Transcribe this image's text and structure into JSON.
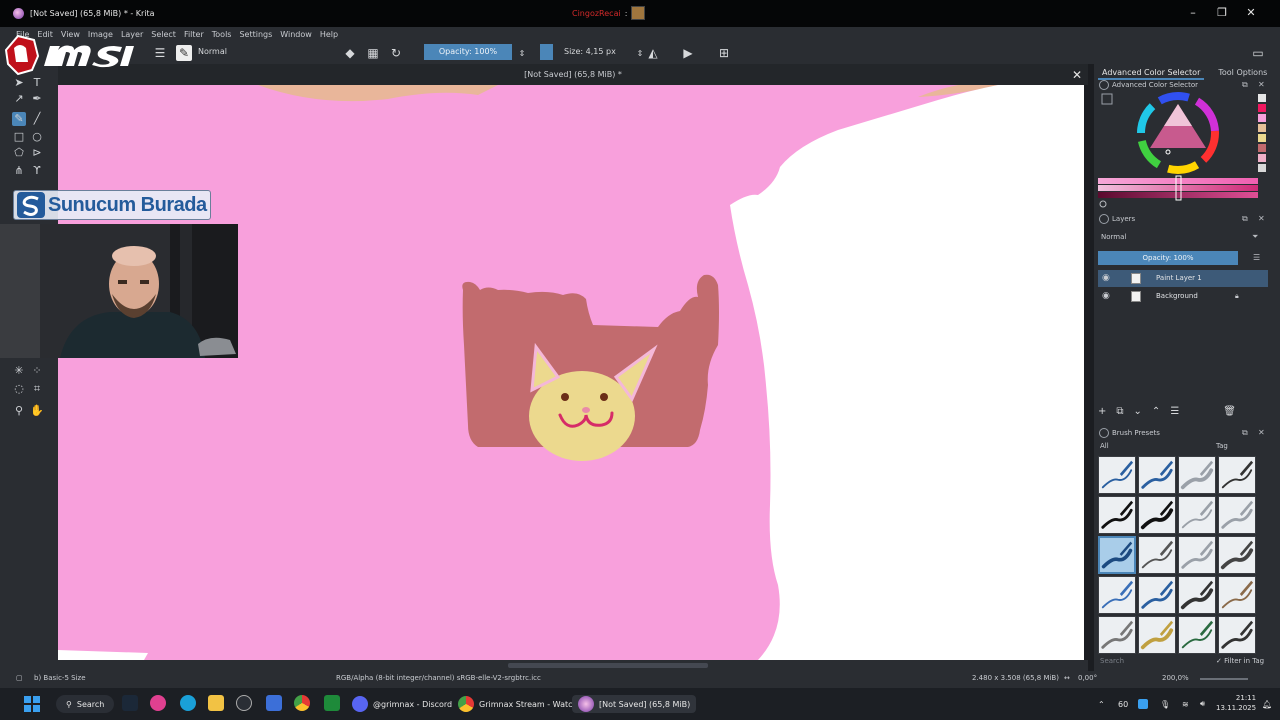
{
  "window": {
    "title": "[Not Saved]  (65,8 MiB) * - Krita",
    "center_name": "CingozRecai"
  },
  "menu": [
    "File",
    "Edit",
    "View",
    "Image",
    "Layer",
    "Select",
    "Filter",
    "Tools",
    "Settings",
    "Window",
    "Help"
  ],
  "toolbar": {
    "blend_mode": "Normal",
    "opacity": "Opacity: 100%",
    "size": "Size: 4,15 px"
  },
  "document": {
    "tab_title": "[Not Saved]  (65,8 MiB) *"
  },
  "overlay": {
    "brand_text": "Sunucum Burada"
  },
  "dock": {
    "tabs": [
      "Advanced Color Selector",
      "Tool Options"
    ],
    "color_panel_title": "Advanced Color Selector",
    "layers_title": "Layers",
    "layers_blend": "Normal",
    "layers_opacity": "Opacity:  100%",
    "layers": [
      {
        "name": "Paint Layer 1",
        "selected": true
      },
      {
        "name": "Background",
        "selected": false
      }
    ],
    "presets_title": "Brush Presets",
    "presets_filter": "All",
    "presets_tag": "Tag",
    "presets_search_placeholder": "Search",
    "filter_in_tag": "Filter in Tag"
  },
  "status": {
    "brush": "b) Basic-5 Size",
    "color_profile": "RGB/Alpha (8-bit integer/channel)  sRGB-elle-V2-srgbtrc.icc",
    "dimensions": "2.480 x 3.508 (65,8 MiB)",
    "rotation": "0,00°",
    "zoom": "200,0%"
  },
  "taskbar": {
    "search": "Search",
    "discord": "@grimnax - Discord",
    "chrome": "Grimnax Stream - Watch",
    "krita": "[Not Saved]  (65,8 MiB)",
    "tray_num": "60",
    "time": "21:11",
    "date": "13.11.2025"
  },
  "colors": {
    "canvas_pink": "#f8a0dc",
    "blob": "#c26b6e",
    "face": "#ecd98e",
    "accent": "#4b86b8"
  }
}
